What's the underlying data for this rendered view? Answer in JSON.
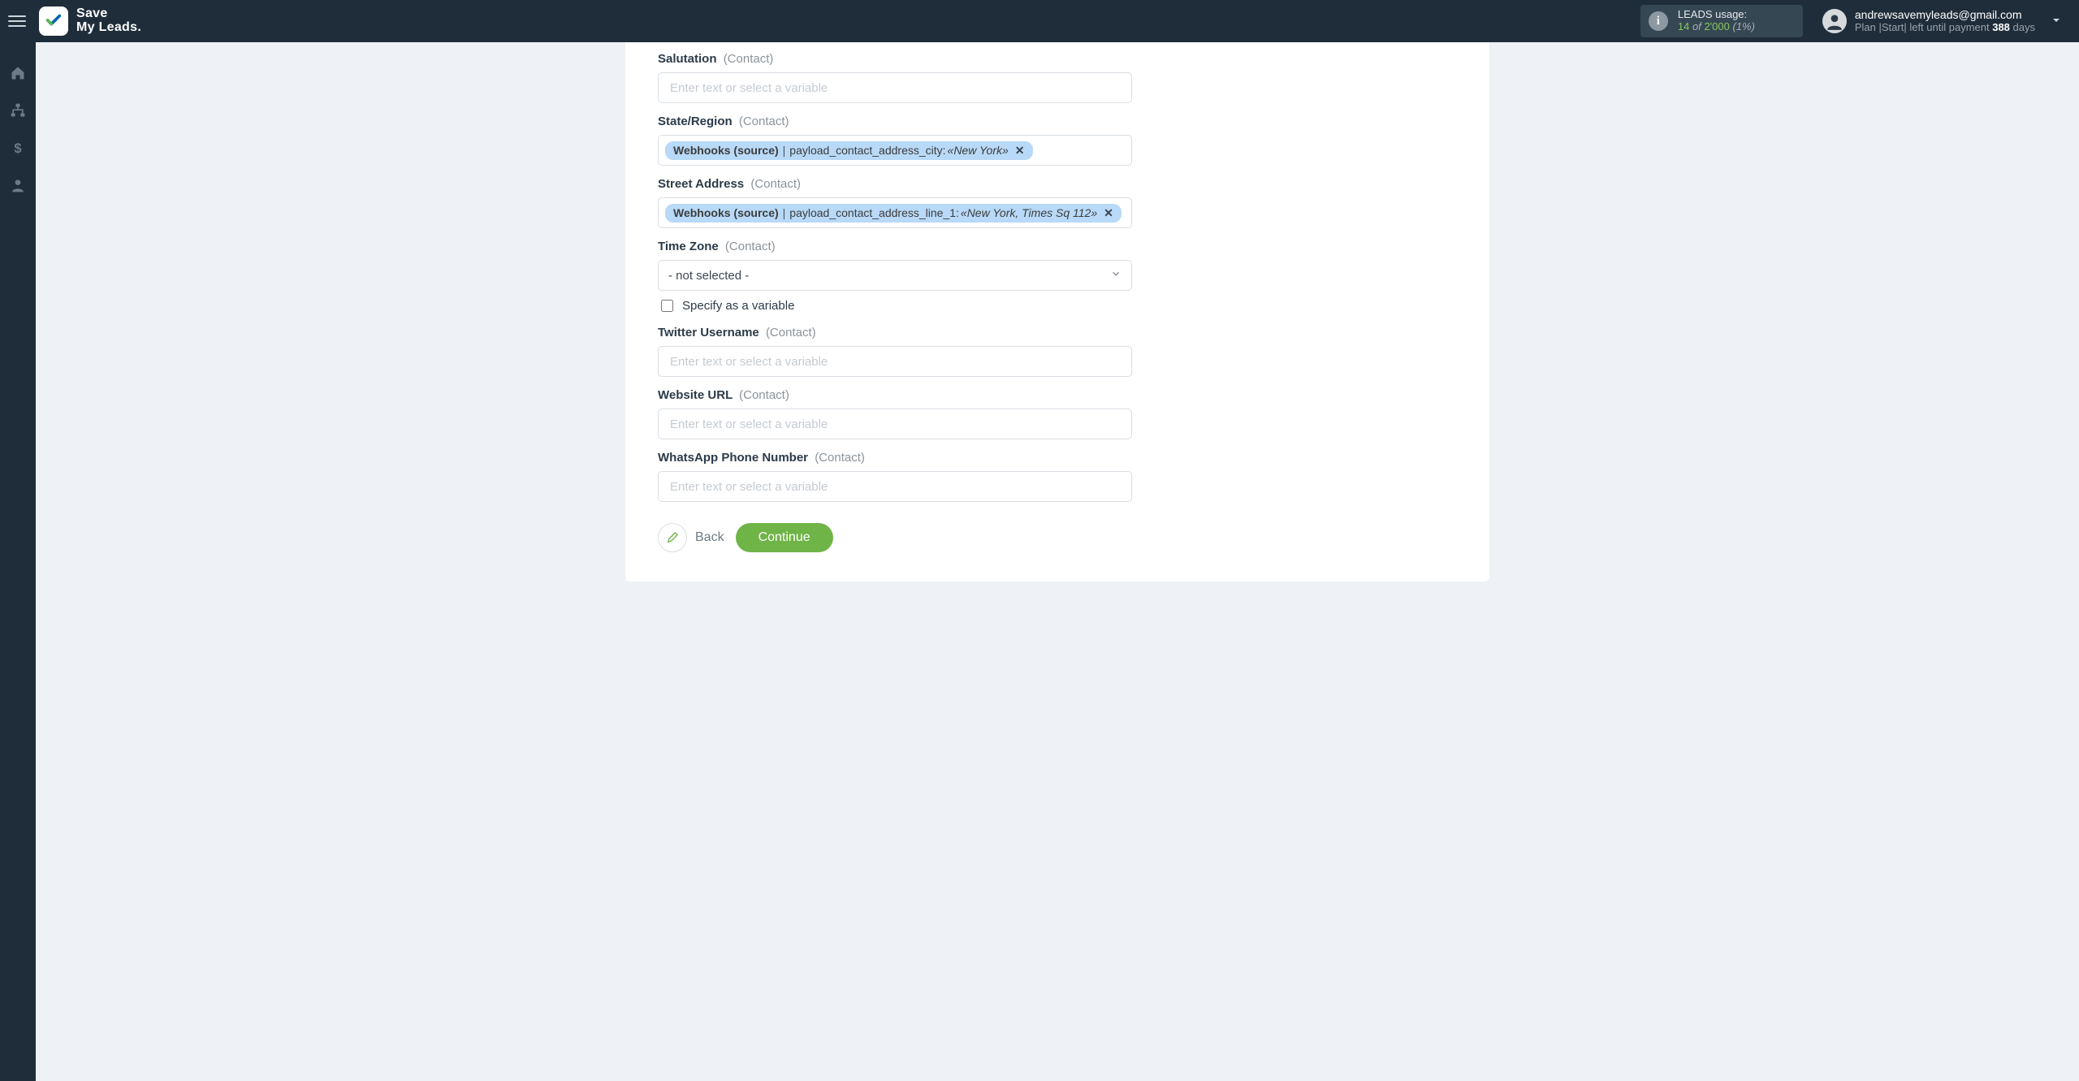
{
  "brand": {
    "line1": "Save",
    "line2": "My Leads"
  },
  "usage": {
    "title": "LEADS usage:",
    "used": "14",
    "of_word": "of",
    "total": "2'000",
    "percent": "(1%)"
  },
  "account": {
    "email": "andrewsavemyleads@gmail.com",
    "plan_prefix": "Plan |Start| left until payment ",
    "days": "388",
    "plan_suffix": " days"
  },
  "form": {
    "placeholders": {
      "text": "Enter text or select a variable"
    },
    "salutation": {
      "label": "Salutation",
      "context": "(Contact)"
    },
    "state_region": {
      "label": "State/Region",
      "context": "(Contact)",
      "chip_source": "Webhooks (source)",
      "chip_path": "payload_contact_address_city:",
      "chip_value": "«New York»"
    },
    "street_address": {
      "label": "Street Address",
      "context": "(Contact)",
      "chip_source": "Webhooks (source)",
      "chip_path": "payload_contact_address_line_1:",
      "chip_value": "«New York, Times Sq 112»"
    },
    "time_zone": {
      "label": "Time Zone",
      "context": "(Contact)",
      "selected": "- not selected -",
      "specify_label": "Specify as a variable"
    },
    "twitter": {
      "label": "Twitter Username",
      "context": "(Contact)"
    },
    "website": {
      "label": "Website URL",
      "context": "(Contact)"
    },
    "whatsapp": {
      "label": "WhatsApp Phone Number",
      "context": "(Contact)"
    },
    "back_label": "Back",
    "continue_label": "Continue"
  }
}
